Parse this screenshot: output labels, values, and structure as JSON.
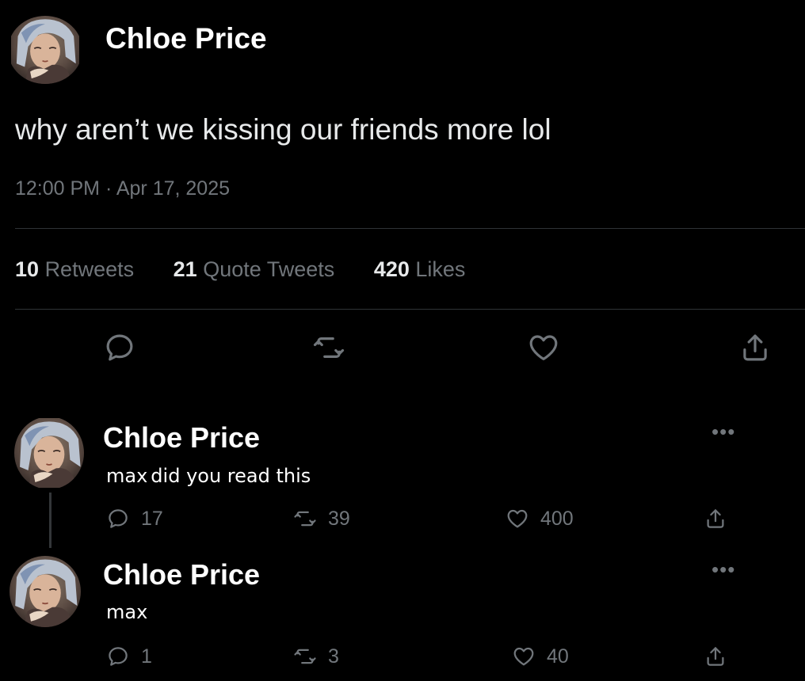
{
  "main_tweet": {
    "author": "Chloe Price",
    "text": "why aren’t we kissing our friends more lol",
    "timestamp": "12:00 PM · Apr 17, 2025",
    "stats": {
      "retweets_count": "10",
      "retweets_label": "Retweets",
      "quotes_count": "21",
      "quotes_label": "Quote Tweets",
      "likes_count": "420",
      "likes_label": "Likes"
    }
  },
  "replies": [
    {
      "author": "Chloe Price",
      "handle": "max",
      "text": "did you read this",
      "replies": "17",
      "retweets": "39",
      "likes": "400"
    },
    {
      "author": "Chloe Price",
      "handle": "max",
      "text": "",
      "replies": "1",
      "retweets": "3",
      "likes": "40"
    }
  ],
  "more_label": "•••",
  "colors": {
    "background": "#000000",
    "text_primary": "#e7e9ea",
    "text_secondary": "#71767b",
    "divider": "#2f3336"
  },
  "icons": [
    "reply-icon",
    "retweet-icon",
    "like-icon",
    "share-icon",
    "more-icon"
  ]
}
